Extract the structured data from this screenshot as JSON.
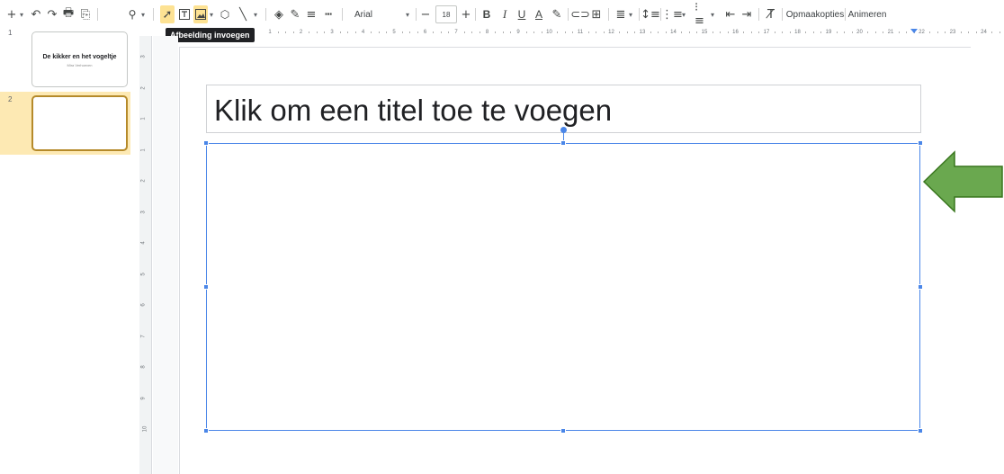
{
  "toolbar": {
    "font_name": "Arial",
    "font_size": "18",
    "format_options_label": "Opmaakopties",
    "animate_label": "Animeren",
    "tooltip": "Afbeelding invoegen"
  },
  "filmstrip": {
    "slides": [
      {
        "number": "1",
        "title": "De kikker en het vogeltje",
        "subtitle": "Mira Verhoeven"
      },
      {
        "number": "2",
        "title": "",
        "subtitle": ""
      }
    ]
  },
  "ruler": {
    "horizontal": [
      "1",
      "2",
      "3",
      "4",
      "5",
      "6",
      "7",
      "8",
      "9",
      "10",
      "11",
      "12",
      "13",
      "14",
      "15",
      "16",
      "17",
      "18",
      "19",
      "20",
      "21",
      "22",
      "23",
      "24"
    ],
    "vertical": [
      "3",
      "2",
      "1",
      "1",
      "2",
      "3",
      "4",
      "5",
      "6",
      "7",
      "8",
      "9",
      "10"
    ]
  },
  "slide": {
    "title_placeholder": "Klik om een titel toe te voegen"
  },
  "colors": {
    "selection": "#4a86e8",
    "selected_slide_bg": "#fde9b3",
    "active_tool_bg": "#fde293",
    "arrow_fill": "#6aa84f",
    "arrow_stroke": "#38761d"
  }
}
